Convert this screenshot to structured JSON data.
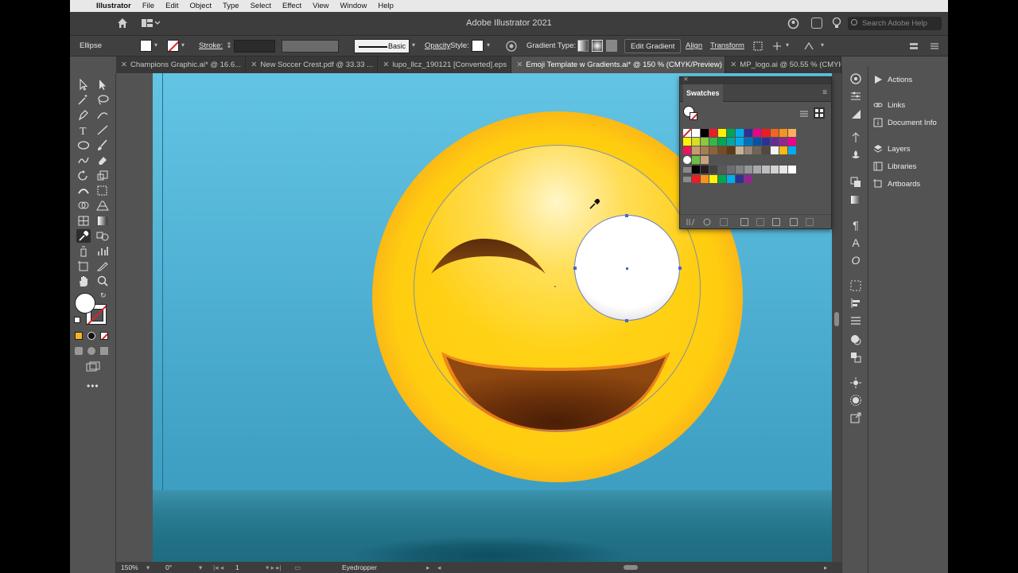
{
  "menubar": {
    "items": [
      "Illustrator",
      "File",
      "Edit",
      "Object",
      "Type",
      "Select",
      "Effect",
      "View",
      "Window",
      "Help"
    ]
  },
  "titlebar": {
    "title": "Adobe Illustrator 2021",
    "search_placeholder": "Search Adobe Help"
  },
  "control": {
    "selection": "Ellipse",
    "stroke_label": "Stroke:",
    "basic": "Basic",
    "opacity_label": "Opacity",
    "style_label": "Style:",
    "gradient_type_label": "Gradient Type:",
    "edit_gradient": "Edit Gradient",
    "align": "Align",
    "transform": "Transform"
  },
  "tabs": [
    {
      "label": "Champions Graphic.ai* @ 16.6...",
      "active": false
    },
    {
      "label": "New Soccer Crest.pdf @ 33.33 ...",
      "active": false
    },
    {
      "label": "lupo_llcz_190121 [Converted].eps",
      "active": false
    },
    {
      "label": "Emoji Template w Gradients.ai* @ 150 % (CMYK/Preview)",
      "active": true
    },
    {
      "label": "MP_logo.ai @ 50.55 % (CMYK/...",
      "active": false
    }
  ],
  "swatches": {
    "title": "Swatches",
    "row1": [
      "#ffffff",
      "#000000",
      "#ee1c24",
      "#fff200",
      "#00a651",
      "#00aeef",
      "#2e3192",
      "#ec008c",
      "#ed1c24",
      "#f26522",
      "#f7941d",
      "#fbaf5d"
    ],
    "row2": [
      "#fff200",
      "#d7df23",
      "#8dc63f",
      "#39b54a",
      "#00a651",
      "#00a99d",
      "#00aeef",
      "#0072bc",
      "#0054a6",
      "#2e3192",
      "#662d91",
      "#92278f",
      "#ec008c"
    ],
    "row3": [
      "#ed145b",
      "#c69c6d",
      "#a67c52",
      "#8c6239",
      "#754c24",
      "#603913",
      "#c7b299",
      "#998675",
      "#736357",
      "#534741",
      "#f1f2f2",
      "#fdb913",
      "#00aeef"
    ],
    "row5": [
      "#000000",
      "#231f20",
      "#414042",
      "#58595b",
      "#6d6e71",
      "#808285",
      "#939598",
      "#a7a9ac",
      "#bcbec0",
      "#d1d3d4",
      "#e6e7e8",
      "#ffffff"
    ],
    "row6": [
      "#ed1c24",
      "#f7941d",
      "#fff200",
      "#00a651",
      "#00aeef",
      "#2e3192",
      "#92278f"
    ]
  },
  "right_panels": {
    "actions": "Actions",
    "links": "Links",
    "document_info": "Document Info",
    "layers": "Layers",
    "libraries": "Libraries",
    "artboards": "Artboards"
  },
  "status": {
    "zoom": "150%",
    "rotation": "0°",
    "artboard_num": "1",
    "tool": "Eyedropper"
  }
}
